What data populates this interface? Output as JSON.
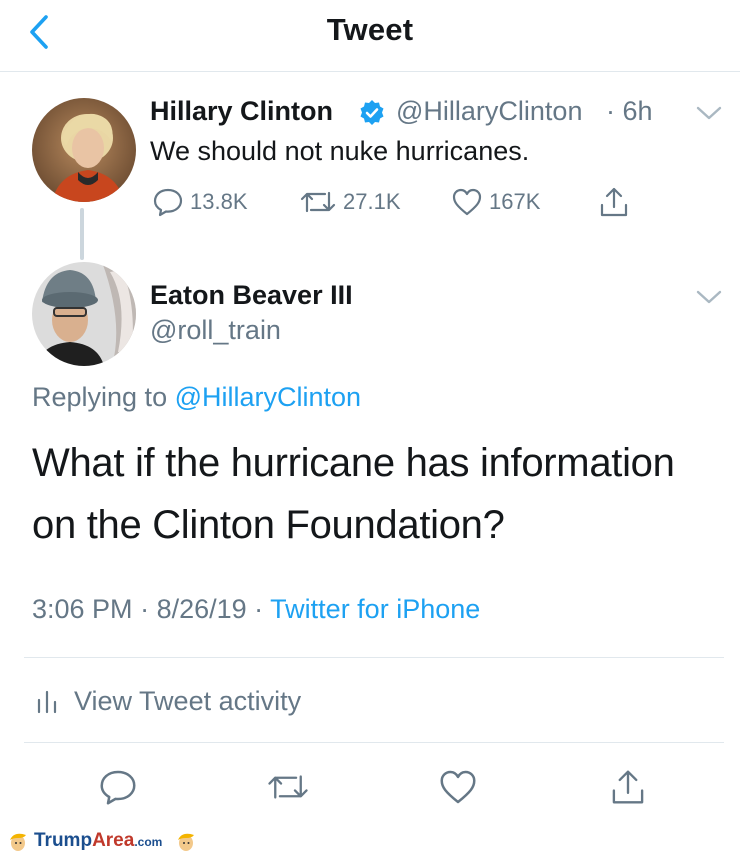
{
  "header": {
    "title": "Tweet",
    "back_icon": "chevron-left-icon"
  },
  "original_tweet": {
    "name": "Hillary Clinton",
    "handle": "@HillaryClinton",
    "time": "· 6h",
    "text": "We should not nuke hurricanes.",
    "replies": "13.8K",
    "retweets": "27.1K",
    "likes": "167K"
  },
  "reply_tweet": {
    "name": "Eaton Beaver III",
    "handle": "@roll_train",
    "replying_prefix": "Replying to",
    "replying_to": "@HillaryClinton",
    "text": "What if the hurricane has information on the Clinton Foundation?",
    "time": "3:06 PM",
    "date": "· 8/26/19 ·",
    "source": "Twitter for iPhone"
  },
  "activity": {
    "label": "View Tweet activity"
  },
  "watermark": {
    "brand_main": "Trump",
    "brand_accent": "Area",
    "brand_suffix": ".com"
  },
  "colors": {
    "accent": "#1da1f2",
    "secondary_text": "#657786",
    "divider": "#e1e8ed"
  }
}
